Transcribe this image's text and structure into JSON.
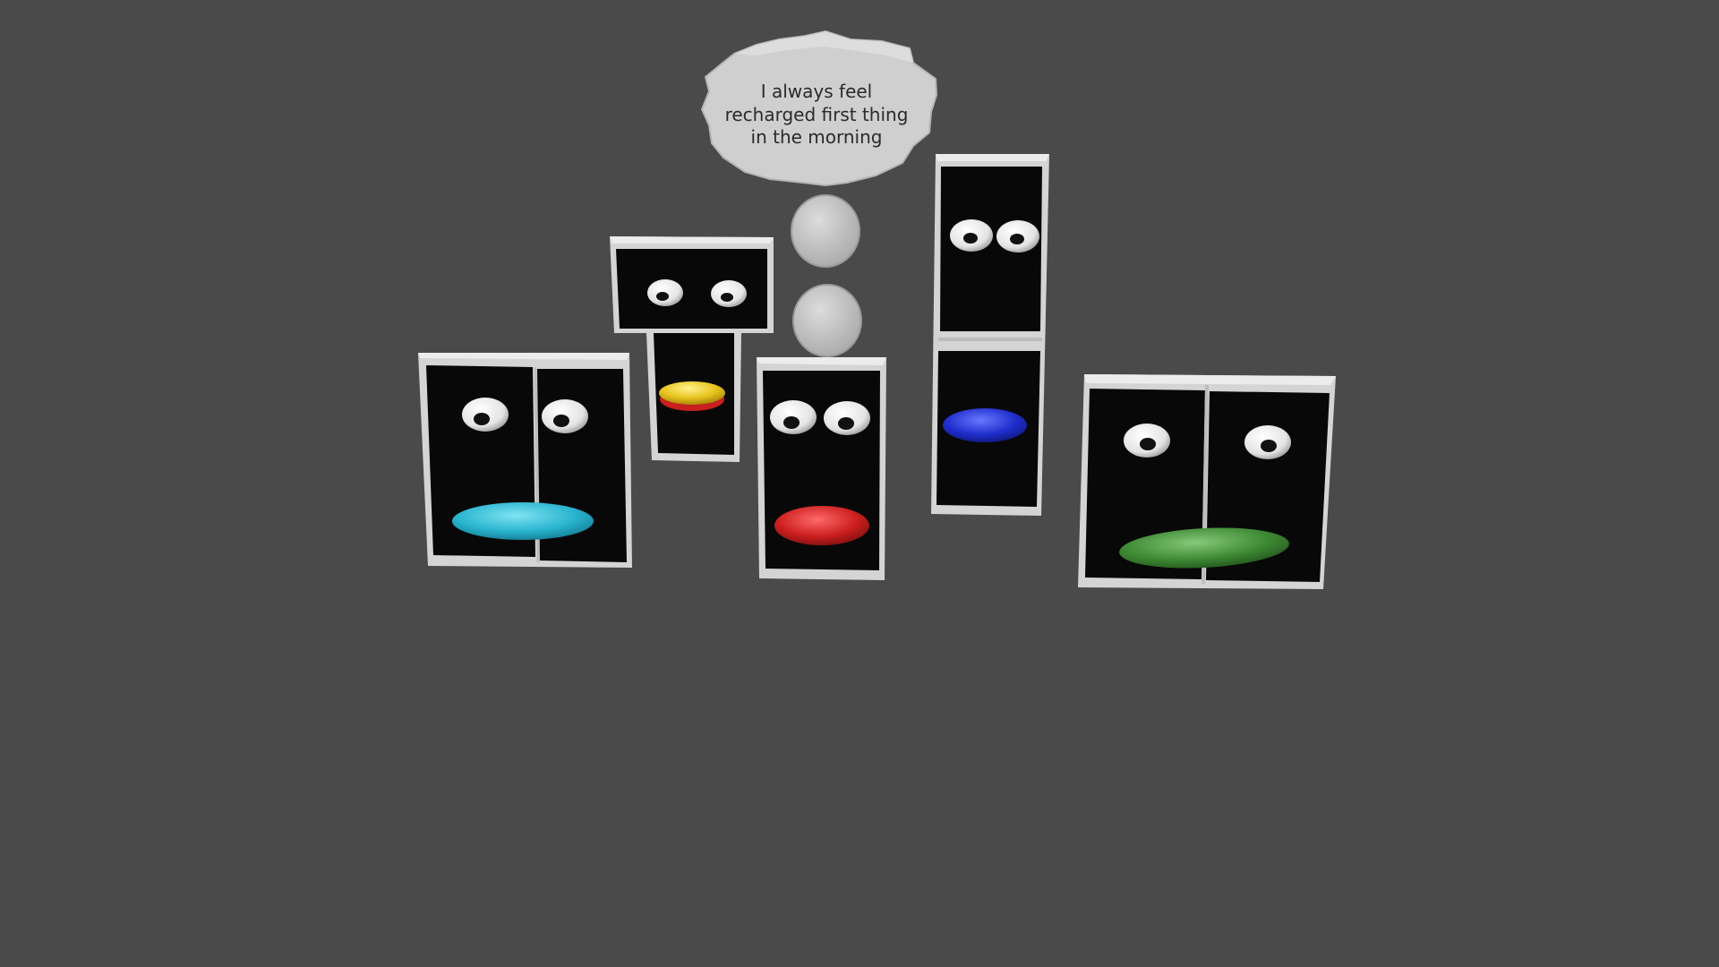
{
  "scene": {
    "background_color": "#4a4a4a"
  },
  "thought_bubble": {
    "lines": [
      "I always feel",
      "recharged first thing",
      "in the morning"
    ],
    "color": "#d2d2d2"
  },
  "characters": [
    {
      "name": "cyan-mouth-character",
      "mouth_color": "#2ab4cf"
    },
    {
      "name": "yellow-mouth-character",
      "mouth_color": "#e7c21c",
      "mouth_lower_color": "#cc2222"
    },
    {
      "name": "red-mouth-character",
      "mouth_color": "#cc1f1f"
    },
    {
      "name": "blue-mouth-character",
      "mouth_color": "#1f2ecc"
    },
    {
      "name": "green-mouth-character",
      "mouth_color": "#3f8a35"
    }
  ]
}
